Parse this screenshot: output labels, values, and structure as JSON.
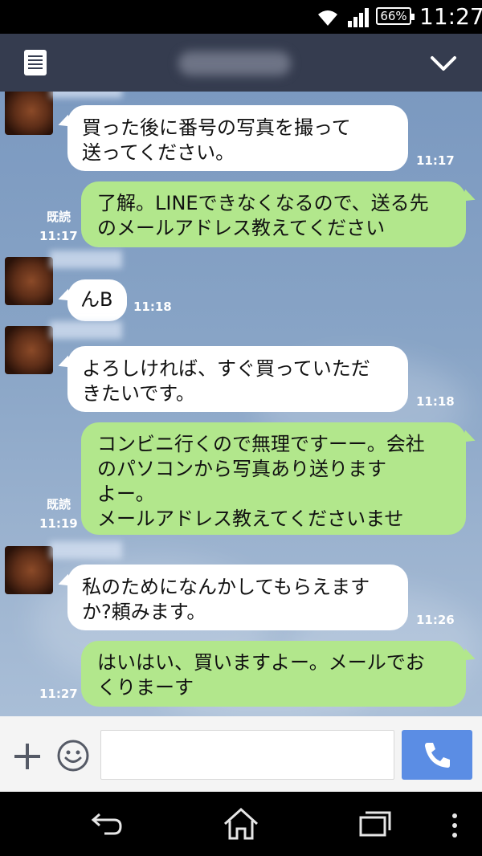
{
  "status_bar": {
    "battery": "66%",
    "time": "11:27"
  },
  "chat": {
    "messages": [
      {
        "dir": "in",
        "lines": [
          "買った後に番号の写真を撮って",
          "送ってください。"
        ],
        "time": "11:17"
      },
      {
        "dir": "out",
        "lines": [
          "了解。LINEできなくなるので、送る先",
          "のメールアドレス教えてください"
        ],
        "read": "既読",
        "time": "11:17"
      },
      {
        "dir": "in",
        "lines": [
          "んB"
        ],
        "time": "11:18"
      },
      {
        "dir": "in",
        "lines": [
          "よろしければ、すぐ買っていただ",
          "きたいです。"
        ],
        "time": "11:18"
      },
      {
        "dir": "out",
        "lines": [
          "コンビニ行くので無理ですーー。会社",
          "のパソコンから写真あり送ります",
          "よー。",
          "メールアドレス教えてくださいませ"
        ],
        "read": "既読",
        "time": "11:19"
      },
      {
        "dir": "in",
        "lines": [
          "私のためになんかしてもらえます",
          "か?頼みます。"
        ],
        "time": "11:26"
      },
      {
        "dir": "out",
        "lines": [
          "はいはい、買いますよー。メールでお",
          "くりまーす"
        ],
        "time": "11:27"
      }
    ]
  },
  "input": {
    "placeholder": ""
  },
  "icons": {
    "menu": "menu-list-icon",
    "collapse": "chevron-down-icon",
    "plus": "plus-icon",
    "emoji": "emoji-icon",
    "call": "phone-icon",
    "back": "back-icon",
    "home": "home-icon",
    "recents": "recent-apps-icon",
    "overflow": "more-vert-icon"
  },
  "colors": {
    "header": "#353c4f",
    "out_bubble": "#b2e78c",
    "in_bubble": "#ffffff",
    "call": "#5b8de4"
  }
}
